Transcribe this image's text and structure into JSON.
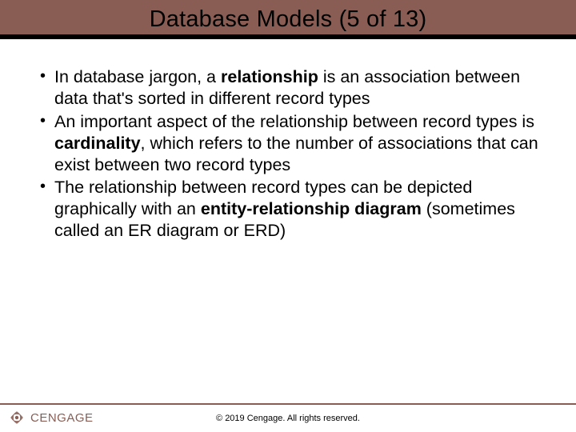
{
  "title": "Database Models (5 of 13)",
  "bullets": [
    {
      "pre": "In database jargon, a ",
      "bold": "relationship",
      "post": " is an association between data that's sorted in different record types"
    },
    {
      "pre": "An important aspect of the relationship between record types is ",
      "bold": "cardinality",
      "post": ", which refers to the number of associations that can exist between two record types"
    },
    {
      "pre": "The relationship between record types can be depicted graphically with an ",
      "bold": "entity-relationship diagram",
      "post": " (sometimes called an ER diagram or ERD)"
    }
  ],
  "footer": {
    "brand": "CENGAGE",
    "copyright": "© 2019 Cengage. All rights reserved."
  }
}
